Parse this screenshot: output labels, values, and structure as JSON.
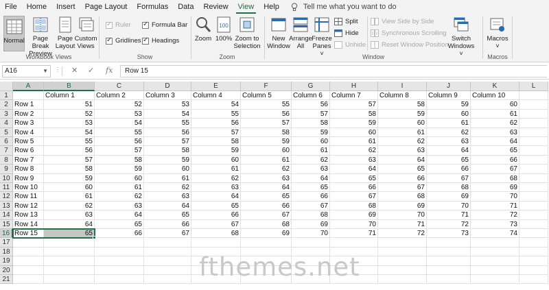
{
  "menu": {
    "tabs": [
      "File",
      "Home",
      "Insert",
      "Page Layout",
      "Formulas",
      "Data",
      "Review",
      "View",
      "Help"
    ],
    "active": "View",
    "tell_me": "Tell me what you want to do"
  },
  "ribbon": {
    "workbook_views": {
      "label": "Workbook Views",
      "normal": [
        "Normal"
      ],
      "page_break": [
        "Page Break",
        "Preview"
      ],
      "page_layout": [
        "Page",
        "Layout"
      ],
      "custom_views": [
        "Custom",
        "Views"
      ]
    },
    "show": {
      "label": "Show",
      "ruler": "Ruler",
      "formula_bar": "Formula Bar",
      "gridlines": "Gridlines",
      "headings": "Headings"
    },
    "zoom": {
      "label": "Zoom",
      "zoom": [
        "Zoom"
      ],
      "hundred": [
        "100%"
      ],
      "zoom_selection": [
        "Zoom to",
        "Selection"
      ]
    },
    "window": {
      "label": "Window",
      "new_window": [
        "New",
        "Window"
      ],
      "arrange_all": [
        "Arrange",
        "All"
      ],
      "freeze_panes": [
        "Freeze",
        "Panes ˅"
      ],
      "split": "Split",
      "hide": "Hide",
      "unhide": "Unhide",
      "side_by_side": "View Side by Side",
      "sync_scroll": "Synchronous Scrolling",
      "reset_pos": "Reset Window Position",
      "switch_windows": [
        "Switch",
        "Windows ˅"
      ]
    },
    "macros": {
      "label": "Macros",
      "macros": [
        "Macros",
        "˅"
      ]
    }
  },
  "formula_bar": {
    "name_box": "A16",
    "content": "Row 15",
    "fx": "fx"
  },
  "sheet": {
    "columns": [
      "A",
      "B",
      "C",
      "D",
      "E",
      "F",
      "G",
      "H",
      "I",
      "J",
      "K",
      "L"
    ],
    "row_numbers": [
      "1",
      "2",
      "3",
      "4",
      "5",
      "6",
      "7",
      "8",
      "9",
      "10",
      "11",
      "12",
      "13",
      "14",
      "15",
      "16",
      "17",
      "18",
      "19",
      "20",
      "21"
    ],
    "header_row": [
      "",
      "Column 1",
      "Column 2",
      "Column 3",
      "Column 4",
      "Column 5",
      "Column 6",
      "Column 7",
      "Column 8",
      "Column 9",
      "Column 10"
    ],
    "rows": [
      [
        "Row 1",
        "51",
        "52",
        "53",
        "54",
        "55",
        "56",
        "57",
        "58",
        "59",
        "60"
      ],
      [
        "Row 2",
        "52",
        "53",
        "54",
        "55",
        "56",
        "57",
        "58",
        "59",
        "60",
        "61"
      ],
      [
        "Row 3",
        "53",
        "54",
        "55",
        "56",
        "57",
        "58",
        "59",
        "60",
        "61",
        "62"
      ],
      [
        "Row 4",
        "54",
        "55",
        "56",
        "57",
        "58",
        "59",
        "60",
        "61",
        "62",
        "63"
      ],
      [
        "Row 5",
        "55",
        "56",
        "57",
        "58",
        "59",
        "60",
        "61",
        "62",
        "63",
        "64"
      ],
      [
        "Row 6",
        "56",
        "57",
        "58",
        "59",
        "60",
        "61",
        "62",
        "63",
        "64",
        "65"
      ],
      [
        "Row 7",
        "57",
        "58",
        "59",
        "60",
        "61",
        "62",
        "63",
        "64",
        "65",
        "66"
      ],
      [
        "Row 8",
        "58",
        "59",
        "60",
        "61",
        "62",
        "63",
        "64",
        "65",
        "66",
        "67"
      ],
      [
        "Row 9",
        "59",
        "60",
        "61",
        "62",
        "63",
        "64",
        "65",
        "66",
        "67",
        "68"
      ],
      [
        "Row 10",
        "60",
        "61",
        "62",
        "63",
        "64",
        "65",
        "66",
        "67",
        "68",
        "69"
      ],
      [
        "Row 11",
        "61",
        "62",
        "63",
        "64",
        "65",
        "66",
        "67",
        "68",
        "69",
        "70"
      ],
      [
        "Row 12",
        "62",
        "63",
        "64",
        "65",
        "66",
        "67",
        "68",
        "69",
        "70",
        "71"
      ],
      [
        "Row 13",
        "63",
        "64",
        "65",
        "66",
        "67",
        "68",
        "69",
        "70",
        "71",
        "72"
      ],
      [
        "Row 14",
        "64",
        "65",
        "66",
        "67",
        "68",
        "69",
        "70",
        "71",
        "72",
        "73"
      ],
      [
        "Row 15",
        "65",
        "66",
        "67",
        "68",
        "69",
        "70",
        "71",
        "72",
        "73",
        "74"
      ]
    ],
    "selected_cell": "A16",
    "selected_columns": [
      "A",
      "B"
    ],
    "selected_row": "16",
    "accent_color": "#1e7145"
  },
  "watermark": "fthemes.net"
}
